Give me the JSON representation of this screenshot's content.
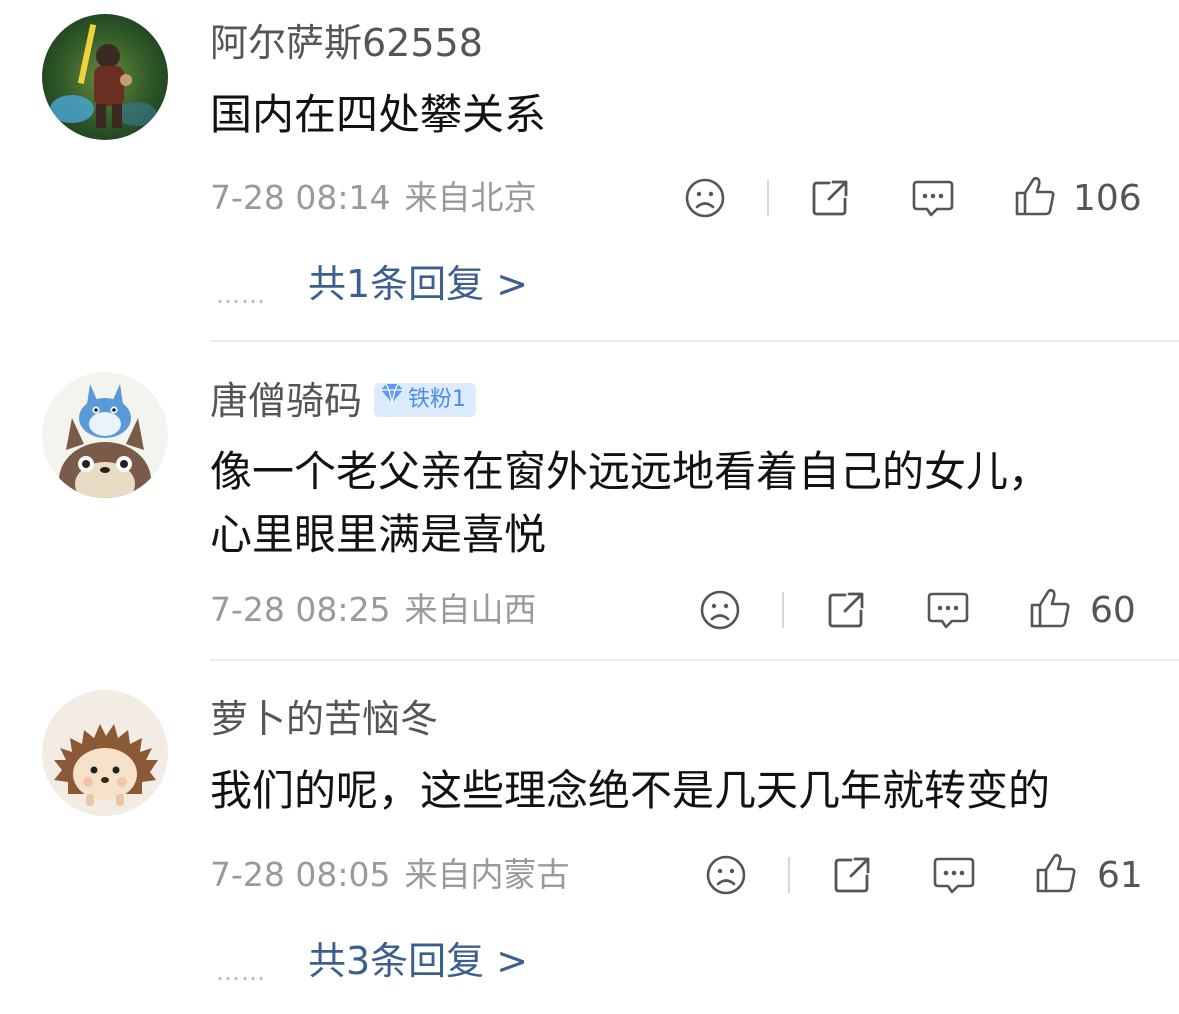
{
  "comments": [
    {
      "username": "阿尔萨斯62558",
      "badge": "",
      "text": "国内在四处攀关系",
      "date": "7-28 08:14",
      "location": "来自北京",
      "likes": "106",
      "replies": "共1条回复 >"
    },
    {
      "username": "唐僧骑码",
      "badge": "铁粉1",
      "text": "像一个老父亲在窗外远远地看着自己的女儿，\n心里眼里满是喜悦",
      "date": "7-28 08:25",
      "location": "来自山西",
      "likes": "60",
      "replies": ""
    },
    {
      "username": "萝卜的苦恼冬",
      "badge": "",
      "text": "我们的呢，这些理念绝不是几天几年就转变的",
      "date": "7-28 08:05",
      "location": "来自内蒙古",
      "likes": "61",
      "replies": "共3条回复 >"
    }
  ],
  "reply_dots": "……",
  "icons": {
    "dislike": "sad-face-icon",
    "share": "share-icon",
    "comment": "comment-bubble-icon",
    "like": "thumbs-up-icon"
  },
  "colors": {
    "link": "#3d5f8f",
    "badge_text": "#4c8ce6",
    "badge_bg": "#dcecfd",
    "meta": "#9a9a9a",
    "icon": "#555555"
  }
}
